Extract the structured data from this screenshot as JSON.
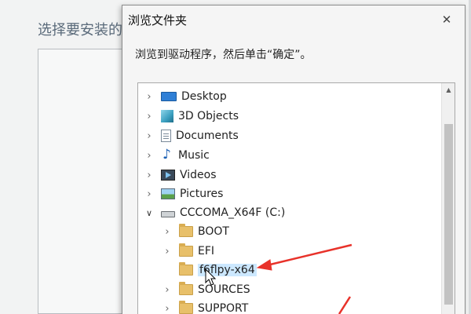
{
  "background": {
    "title": "选择要安装的"
  },
  "dialog": {
    "title": "浏览文件夹",
    "close_glyph": "✕",
    "instruction": "浏览到驱动程序，然后单击“确定”。"
  },
  "tree": {
    "items": [
      {
        "label": "Desktop",
        "icon": "desktop-icon"
      },
      {
        "label": "3D Objects",
        "icon": "3d-objects-icon"
      },
      {
        "label": "Documents",
        "icon": "documents-icon"
      },
      {
        "label": "Music",
        "icon": "music-icon"
      },
      {
        "label": "Videos",
        "icon": "videos-icon"
      },
      {
        "label": "Pictures",
        "icon": "pictures-icon"
      },
      {
        "label": "CCCOMA_X64F (C:)",
        "icon": "drive-icon",
        "expanded": true
      },
      {
        "label": "BOOT",
        "icon": "folder-icon"
      },
      {
        "label": "EFI",
        "icon": "folder-icon"
      },
      {
        "label": "f6flpy-x64",
        "icon": "folder-icon",
        "selected": true
      },
      {
        "label": "SOURCES",
        "icon": "folder-icon"
      },
      {
        "label": "SUPPORT",
        "icon": "folder-icon"
      }
    ]
  },
  "colors": {
    "annotation_arrow": "#e8322a",
    "selection": "#cce8ff"
  }
}
